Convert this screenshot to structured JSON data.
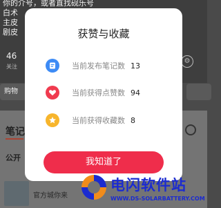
{
  "background": {
    "lines": [
      "你的介号，或者直找砚乐号",
      "白术",
      "主皮",
      "剧皮"
    ],
    "followers_count": "46",
    "followers_label": "关注",
    "chip_left": "购物",
    "tab_notes": "笔记",
    "public_label": "公开",
    "note_author": "官方城你来"
  },
  "dialog": {
    "title": "获赞与收藏",
    "rows": [
      {
        "icon": "note-icon",
        "label": "当前发布笔记数",
        "value": "13",
        "color": "#3d8bf5"
      },
      {
        "icon": "heart-icon",
        "label": "当前获得点赞数",
        "value": "94",
        "color": "#f03b4f"
      },
      {
        "icon": "star-icon",
        "label": "当前获得收藏数",
        "value": "8",
        "color": "#f7b52c"
      }
    ],
    "ok_label": "我知道了"
  },
  "watermark": {
    "name": "电闪软件站",
    "url": "WWW.DS-SOLARBATTERY.COM"
  }
}
